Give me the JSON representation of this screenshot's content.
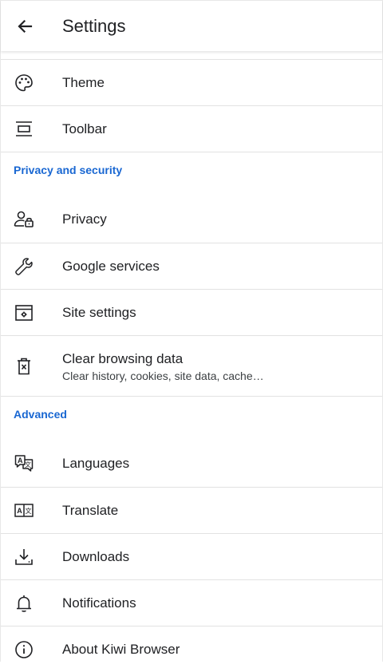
{
  "app_bar": {
    "title": "Settings",
    "back_icon": "arrow-back-icon"
  },
  "items_top": [
    {
      "label": "Theme",
      "icon": "palette-icon"
    },
    {
      "label": "Toolbar",
      "icon": "toolbar-icon"
    }
  ],
  "sections": {
    "privacy": {
      "title": "Privacy and security",
      "items": [
        {
          "label": "Privacy",
          "icon": "person-lock-icon"
        },
        {
          "label": "Google services",
          "icon": "wrench-icon"
        },
        {
          "label": "Site settings",
          "icon": "site-settings-icon"
        },
        {
          "label": "Clear browsing data",
          "sublabel": "Clear history, cookies, site data, cache…",
          "icon": "trash-x-icon"
        }
      ]
    },
    "advanced": {
      "title": "Advanced",
      "items": [
        {
          "label": "Languages",
          "icon": "languages-icon"
        },
        {
          "label": "Translate",
          "icon": "translate-icon"
        },
        {
          "label": "Downloads",
          "icon": "download-icon"
        },
        {
          "label": "Notifications",
          "icon": "bell-icon"
        },
        {
          "label": "About Kiwi Browser",
          "icon": "info-icon"
        }
      ]
    }
  },
  "colors": {
    "accent": "#1967d2",
    "text": "#202124",
    "divider": "#e2e2e2"
  }
}
